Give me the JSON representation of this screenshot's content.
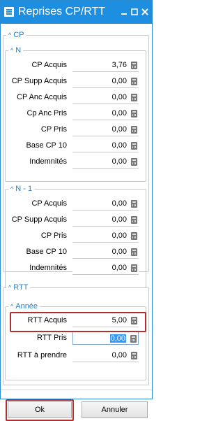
{
  "window": {
    "title": "Reprises CP/RTT",
    "menu_icon": "menu-icon",
    "minimize_icon": "minimize-icon",
    "maximize_icon": "maximize-icon",
    "close_icon": "close-icon"
  },
  "cp": {
    "legend": "CP",
    "n": {
      "legend": "N",
      "rows": [
        {
          "label": "CP Acquis",
          "value": "3,76"
        },
        {
          "label": "CP Supp Acquis",
          "value": "0,00"
        },
        {
          "label": "CP Anc Acquis",
          "value": "0,00"
        },
        {
          "label": "Cp Anc Pris",
          "value": "0,00"
        },
        {
          "label": "CP Pris",
          "value": "0,00"
        },
        {
          "label": "Base CP 10",
          "value": "0,00"
        },
        {
          "label": "Indemnités",
          "value": "0,00"
        }
      ]
    },
    "n1": {
      "legend": "N - 1",
      "rows": [
        {
          "label": "CP Acquis",
          "value": "0,00"
        },
        {
          "label": "CP Supp Acquis",
          "value": "0,00"
        },
        {
          "label": "CP Pris",
          "value": "0,00"
        },
        {
          "label": "Base CP 10",
          "value": "0,00"
        },
        {
          "label": "Indemnités",
          "value": "0,00"
        }
      ]
    }
  },
  "rtt": {
    "legend": "RTT",
    "annee": {
      "legend": "Année",
      "rows": [
        {
          "label": "RTT Acquis",
          "value": "5,00"
        },
        {
          "label": "RTT Pris",
          "value": "0,00"
        },
        {
          "label": "RTT à prendre",
          "value": "0,00"
        }
      ]
    }
  },
  "buttons": {
    "ok": "Ok",
    "cancel": "Annuler"
  },
  "colors": {
    "titlebar": "#1e8fe0",
    "legend_text": "#2d7fbd",
    "highlight": "#b03030",
    "selection": "#3399ff"
  }
}
